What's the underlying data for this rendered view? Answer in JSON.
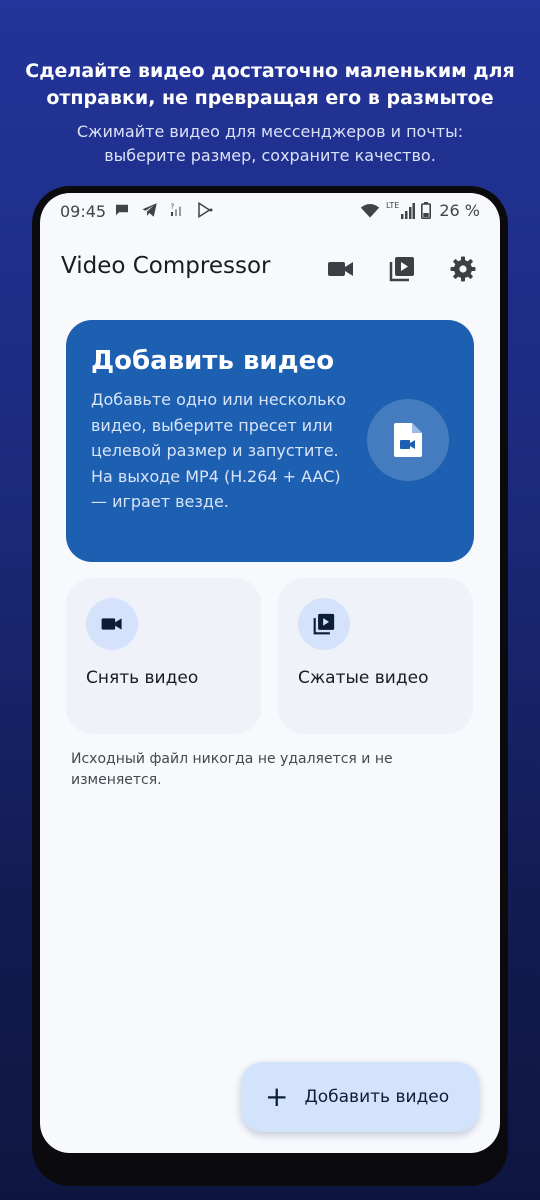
{
  "promo": {
    "title_line1": "Сделайте видео достаточно маленьким для",
    "title_line2": "отправки, не превращая его в размытое",
    "subtitle_line1": "Сжимайте видео для мессенджеров и почты:",
    "subtitle_line2": "выберите размер, сохраните качество."
  },
  "status_bar": {
    "time": "09:45",
    "network_type": "LTE",
    "battery": "26 %"
  },
  "app_bar": {
    "title": "Video Compressor",
    "actions": [
      "videocam-icon",
      "video-library-icon",
      "settings-icon"
    ]
  },
  "hero": {
    "title": "Добавить видео",
    "description": "Добавьте одно или несколько видео, выберите пресет или целевой размер и запустите. На выходе MP4 (H.264 + AAC) — играет везде.",
    "icon": "video-file-icon"
  },
  "tiles": [
    {
      "label": "Снять видео",
      "icon": "videocam-icon"
    },
    {
      "label": "Сжатые видео",
      "icon": "video-library-icon"
    }
  ],
  "note": "Исходный файл никогда не удаляется и не изменяется.",
  "fab": {
    "label": "Добавить видео",
    "icon": "plus-icon"
  },
  "colors": {
    "background_top": "#23349a",
    "hero": "#1d5fb1",
    "tile": "#eff2f9",
    "icon_accent": "#d4e3fb",
    "icon_dark": "#0c1d36"
  }
}
